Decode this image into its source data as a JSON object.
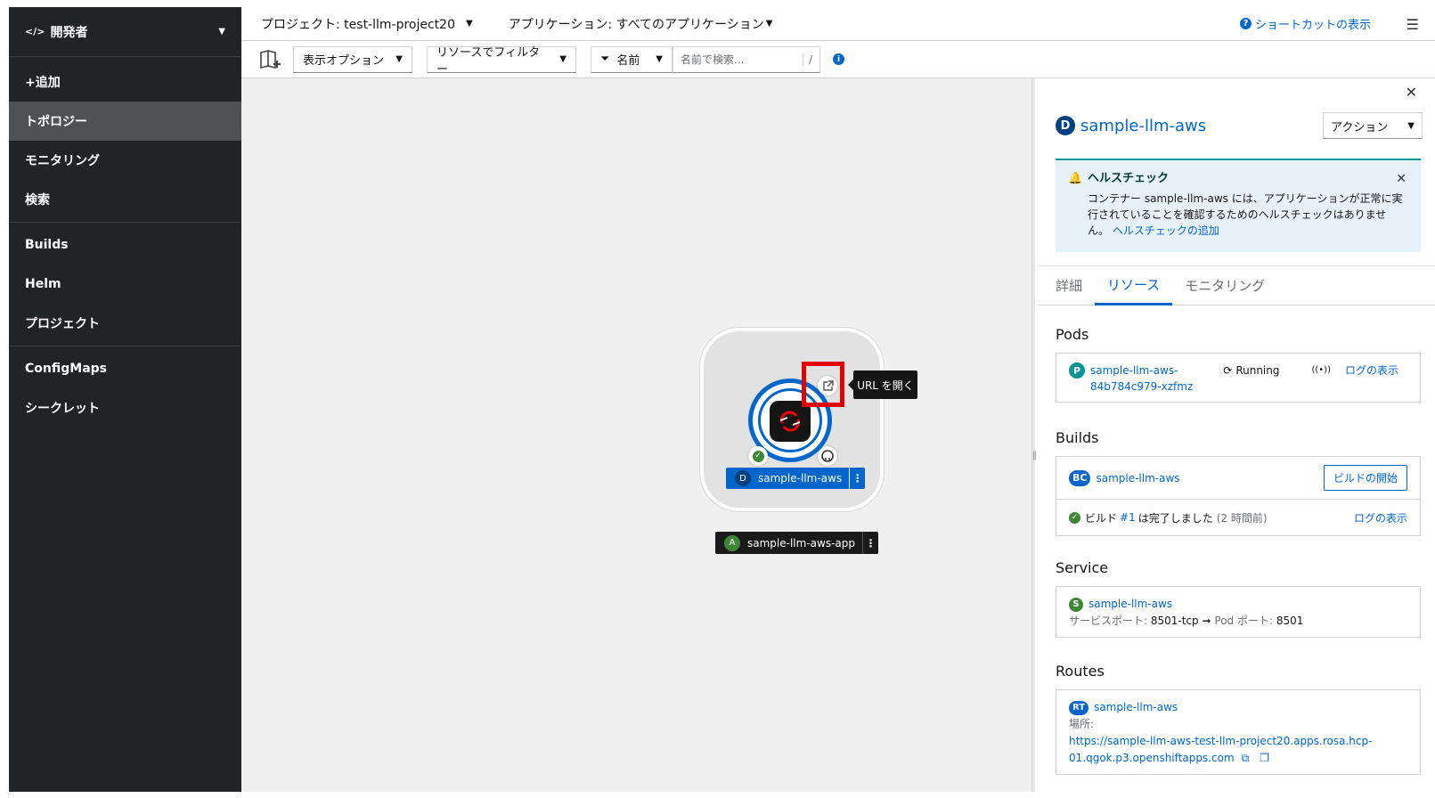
{
  "sidebar": {
    "perspective": "開発者",
    "items": [
      "+追加",
      "トポロジー",
      "モニタリング",
      "検索",
      "Builds",
      "Helm",
      "プロジェクト",
      "ConfigMaps",
      "シークレット"
    ]
  },
  "topbar": {
    "project": "プロジェクト: test-llm-project20",
    "application": "アプリケーション: すべてのアプリケーション",
    "shortcuts": "ショートカットの表示"
  },
  "toolbar": {
    "display_options": "表示オプション",
    "filter_resources": "リソースでフィルター",
    "filter_type": "名前",
    "search_placeholder": "名前で検索...",
    "search_key": "/"
  },
  "topology": {
    "node_badge": "D",
    "node_name": "sample-llm-aws",
    "app_badge": "A",
    "app_name": "sample-llm-aws-app",
    "tooltip": "URL を開く"
  },
  "panel": {
    "badge": "D",
    "title": "sample-llm-aws",
    "actions": "アクション",
    "alert": {
      "title": "ヘルスチェック",
      "body": "コンテナー sample-llm-aws には、アプリケーションが正常に実行されていることを確認するためのヘルスチェックはありません。",
      "link": "ヘルスチェックの追加"
    },
    "tabs": [
      "詳細",
      "リソース",
      "モニタリング"
    ],
    "pods": {
      "title": "Pods",
      "badge": "P",
      "name_line1": "sample-llm-aws-",
      "name_line2": "84b784c979-xzfmz",
      "status": "Running",
      "logs": "ログの表示"
    },
    "builds": {
      "title": "Builds",
      "badge": "BC",
      "name": "sample-llm-aws",
      "start": "ビルドの開始",
      "build_prefix": "ビルド",
      "build_num": "#1",
      "build_suffix": "は完了しました",
      "build_time": "(2 時間前)",
      "logs": "ログの表示"
    },
    "service": {
      "title": "Service",
      "badge": "S",
      "name": "sample-llm-aws",
      "port_label": "サービスポート:",
      "port_value": "8501-tcp",
      "pod_port_label": "Pod ポート:",
      "pod_port_value": "8501"
    },
    "routes": {
      "title": "Routes",
      "badge": "RT",
      "name": "sample-llm-aws",
      "location_label": "場所:",
      "url_line1": "https://sample-llm-aws-test-llm-project20.apps.rosa.hcp-",
      "url_line2": "01.qgok.p3.openshiftapps.com"
    }
  },
  "colors": {
    "sidebar_bg": "#212427",
    "accent": "#0066cc",
    "highlight": "#e00000",
    "success": "#3e8635"
  }
}
